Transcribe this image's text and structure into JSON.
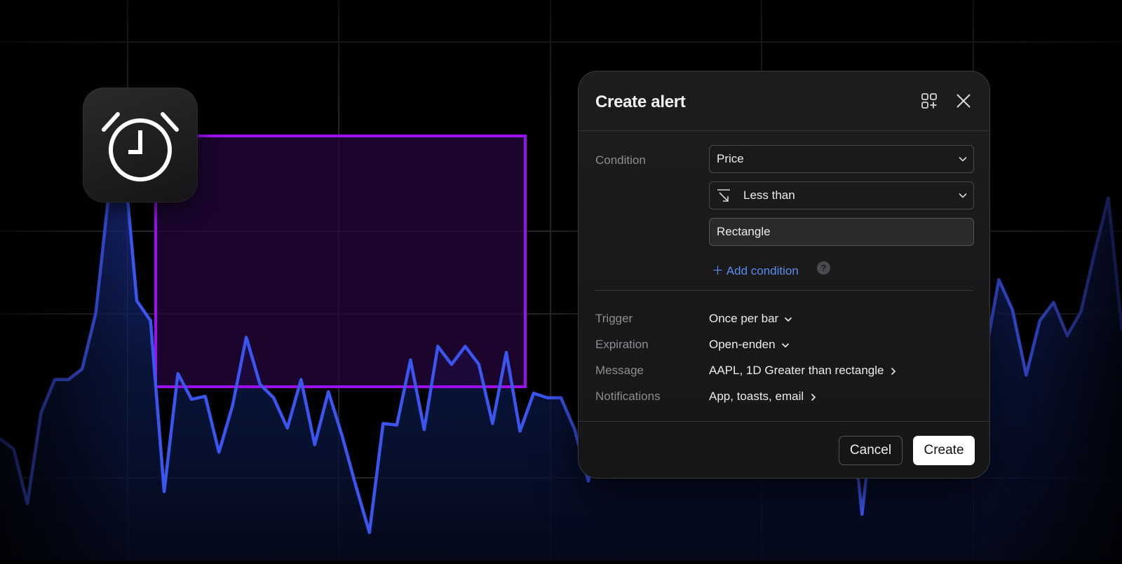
{
  "dialog": {
    "title": "Create alert",
    "condition_label": "Condition",
    "condition_source": "Price",
    "condition_operator": "Less than",
    "condition_target": "Rectangle",
    "add_condition": "Add condition",
    "help_glyph": "?",
    "rows": [
      {
        "label": "Trigger",
        "value": "Once per bar",
        "icon": "chevron-down-icon"
      },
      {
        "label": "Expiration",
        "value": "Open-enden",
        "icon": "chevron-down-icon"
      },
      {
        "label": "Message",
        "value": "AAPL, 1D Greater than rectangle",
        "icon": "chevron-right-icon"
      },
      {
        "label": "Notifications",
        "value": "App, toasts, email",
        "icon": "chevron-right-icon"
      }
    ],
    "cancel_label": "Cancel",
    "create_label": "Create"
  },
  "icons": {
    "app_icon": "alarm-clock-icon",
    "header_left": "add-widget-icon",
    "header_right": "close-icon",
    "operator": "arrow-down-right-icon"
  },
  "colors": {
    "line": "#3b55f0",
    "rectangle_border": "#9b0ff0",
    "rectangle_fill": "#22063a",
    "accent_link": "#5b8ef0"
  },
  "chart_data": {
    "type": "area",
    "values": [
      62,
      55,
      19,
      79,
      101,
      101,
      108,
      145,
      228,
      253,
      153,
      140,
      27,
      105,
      88,
      90,
      53,
      84,
      129,
      98,
      89,
      69,
      101,
      58,
      93,
      64,
      31,
      0,
      72,
      71,
      114,
      68,
      123,
      111,
      123,
      111,
      72,
      119,
      67,
      92,
      89,
      89,
      68,
      34,
      73,
      101,
      125,
      110,
      75,
      64,
      54,
      107,
      55,
      81,
      66,
      48,
      97,
      82,
      72,
      60,
      101,
      88,
      98,
      12,
      93,
      115,
      93,
      120,
      146,
      100,
      135,
      163,
      117,
      167,
      147,
      104,
      140,
      152,
      130,
      146,
      185,
      221,
      134
    ]
  }
}
